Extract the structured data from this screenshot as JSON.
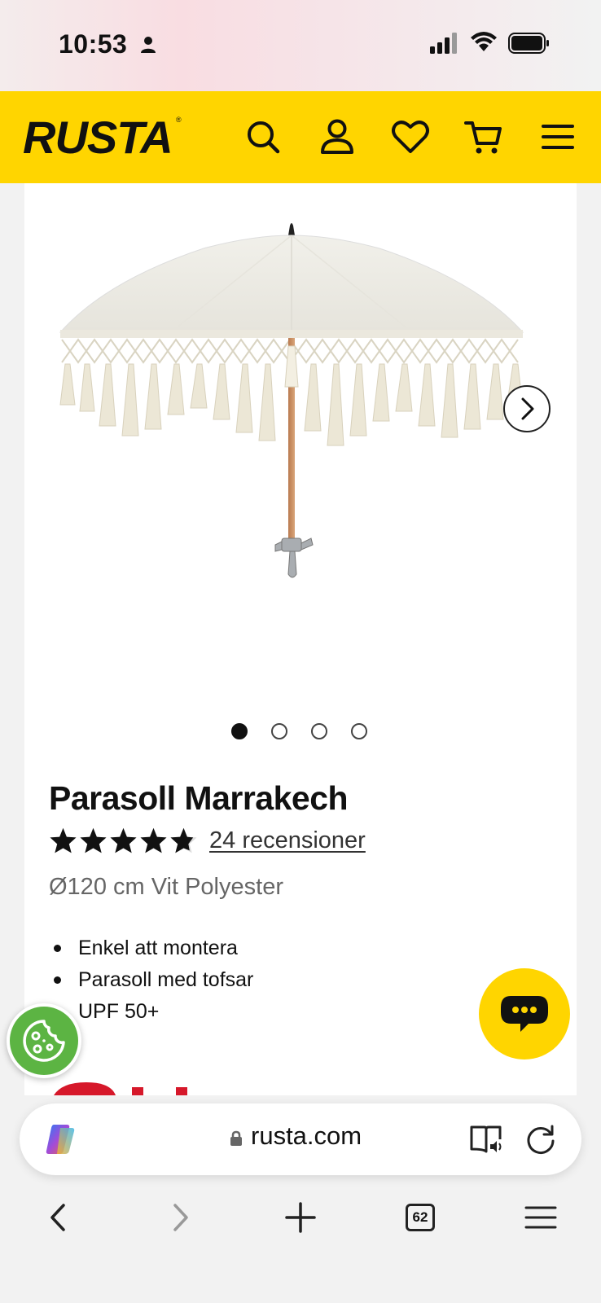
{
  "status_bar": {
    "time": "10:53",
    "icons": [
      "person-icon",
      "cellular-signal-icon",
      "wifi-icon",
      "battery-icon"
    ]
  },
  "header": {
    "logo": "RUSTA",
    "logo_mark": "®",
    "brand_color": "#ffd500",
    "icons": [
      "search-icon",
      "account-icon",
      "heart-icon",
      "cart-icon",
      "menu-icon"
    ]
  },
  "product": {
    "title": "Parasoll Marrakech",
    "rating": 4.5,
    "rating_max": 5,
    "reviews_label": "24 recensioner",
    "subtitle": "Ø120 cm Vit Polyester",
    "features": [
      "Enkel att montera",
      "Parasoll med tofsar",
      "UPF 50+"
    ],
    "image_count": 4,
    "active_image": 1
  },
  "floating": {
    "cookie_icon": "cookie-icon",
    "chat_icon": "chat-icon",
    "chat_color": "#ffd500",
    "cookie_color": "#5cb443"
  },
  "browser": {
    "url": "rusta.com",
    "tab_count": "62",
    "icons": [
      "copilot-icon",
      "lock-icon",
      "reader-icon",
      "reload-icon",
      "back-icon",
      "forward-icon",
      "new-tab-icon",
      "tabs-icon",
      "browser-menu-icon"
    ]
  }
}
